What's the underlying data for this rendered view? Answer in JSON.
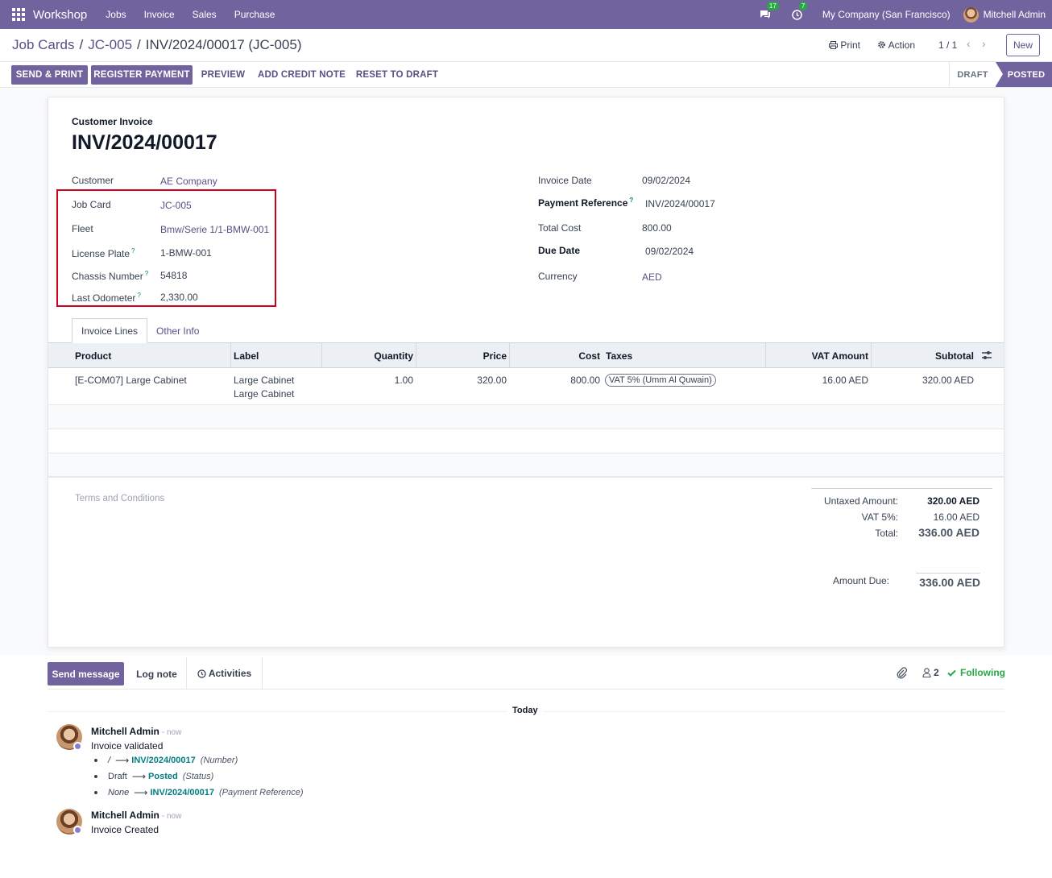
{
  "navbar": {
    "app_name": "Workshop",
    "menu": [
      "Jobs",
      "Invoice",
      "Sales",
      "Purchase"
    ],
    "messages_count": "17",
    "activities_count": "7",
    "company": "My Company (San Francisco)",
    "user": "Mitchell Admin",
    "color": "#71639e"
  },
  "breadcrumb": {
    "items": [
      "Job Cards",
      "JC-005"
    ],
    "current": "INV/2024/00017 (JC-005)"
  },
  "control_panel": {
    "print_label": "Print",
    "action_label": "Action",
    "pager": "1 / 1",
    "new_label": "New"
  },
  "statusbar": {
    "buttons": [
      "SEND & PRINT",
      "REGISTER PAYMENT",
      "PREVIEW",
      "ADD CREDIT NOTE",
      "RESET TO DRAFT"
    ],
    "stages": [
      "DRAFT",
      "POSTED"
    ],
    "active_stage": "POSTED"
  },
  "invoice": {
    "type_label": "Customer Invoice",
    "name": "INV/2024/00017",
    "left_fields": [
      {
        "label": "Customer",
        "value": "AE Company"
      },
      {
        "label": "Job Card",
        "value": "JC-005"
      },
      {
        "label": "Fleet",
        "value": "Bmw/Serie 1/1-BMW-001"
      },
      {
        "label": "License Plate",
        "value": "1-BMW-001"
      },
      {
        "label": "Chassis Number",
        "value": "54818"
      },
      {
        "label": "Last Odometer",
        "value": "2,330.00"
      }
    ],
    "right_fields": [
      {
        "label": "Invoice Date",
        "value": "09/02/2024"
      },
      {
        "label": "Payment Reference",
        "value": "INV/2024/00017"
      },
      {
        "label": "Total Cost",
        "value": "800.00"
      },
      {
        "label": "Due Date",
        "value": "09/02/2024"
      },
      {
        "label": "Currency",
        "value": "AED"
      }
    ],
    "help_mark": "?"
  },
  "tabs": [
    "Invoice Lines",
    "Other Info"
  ],
  "lines": {
    "headers": [
      "Product",
      "Label",
      "Quantity",
      "Price",
      "Cost",
      "Taxes",
      "VAT Amount",
      "Subtotal"
    ],
    "rows": [
      {
        "product": "[E-COM07] Large Cabinet",
        "label_1": "Large Cabinet",
        "label_2": "Large Cabinet",
        "quantity": "1.00",
        "price": "320.00",
        "cost": "800.00",
        "tax": "VAT 5% (Umm Al Quwain)",
        "vat_amount": "16.00 AED",
        "subtotal": "320.00 AED"
      }
    ]
  },
  "terms_placeholder": "Terms and Conditions",
  "totals": {
    "untaxed_label": "Untaxed Amount:",
    "untaxed": "320.00 AED",
    "vat_label": "VAT 5%:",
    "vat": "16.00 AED",
    "total_label": "Total:",
    "total": "336.00 AED",
    "due_label": "Amount Due:",
    "due": "336.00 AED"
  },
  "chatter": {
    "send_message": "Send message",
    "log_note": "Log note",
    "activities": "Activities",
    "followers_count": "2",
    "following": "Following",
    "date_separator": "Today",
    "messages": [
      {
        "author": "Mitchell Admin",
        "when": "- now",
        "body": "Invoice validated",
        "tracking": [
          {
            "old": "/",
            "new": "INV/2024/00017",
            "field": "(Number)"
          },
          {
            "old": "Draft",
            "new": "Posted",
            "field": "(Status)"
          },
          {
            "old": "None",
            "new": "INV/2024/00017",
            "field": "(Payment Reference)"
          }
        ]
      },
      {
        "author": "Mitchell Admin",
        "when": "- now",
        "body": "Invoice Created"
      }
    ]
  }
}
